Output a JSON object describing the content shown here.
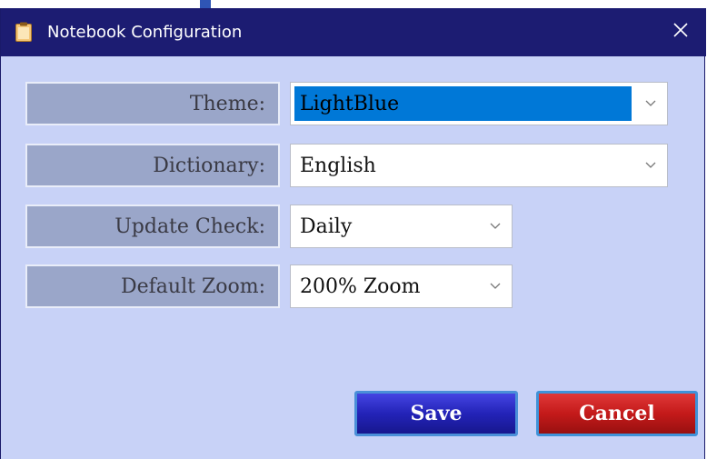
{
  "window": {
    "title": "Notebook Configuration",
    "icon": "clipboard-icon",
    "close_icon": "close-icon"
  },
  "form": {
    "fields": [
      {
        "label": "Theme:",
        "value": "LightBlue"
      },
      {
        "label": "Dictionary:",
        "value": "English"
      },
      {
        "label": "Update Check:",
        "value": "Daily"
      },
      {
        "label": "Default Zoom:",
        "value": "200% Zoom"
      }
    ]
  },
  "buttons": {
    "save_label": "Save",
    "cancel_label": "Cancel"
  },
  "colors": {
    "titlebar": "#1c1c72",
    "client_background": "#c8d2f7",
    "label_background": "#9aa6c9",
    "selection": "#0078d7",
    "save_button": "#2323b8",
    "cancel_button": "#c41a1a"
  }
}
